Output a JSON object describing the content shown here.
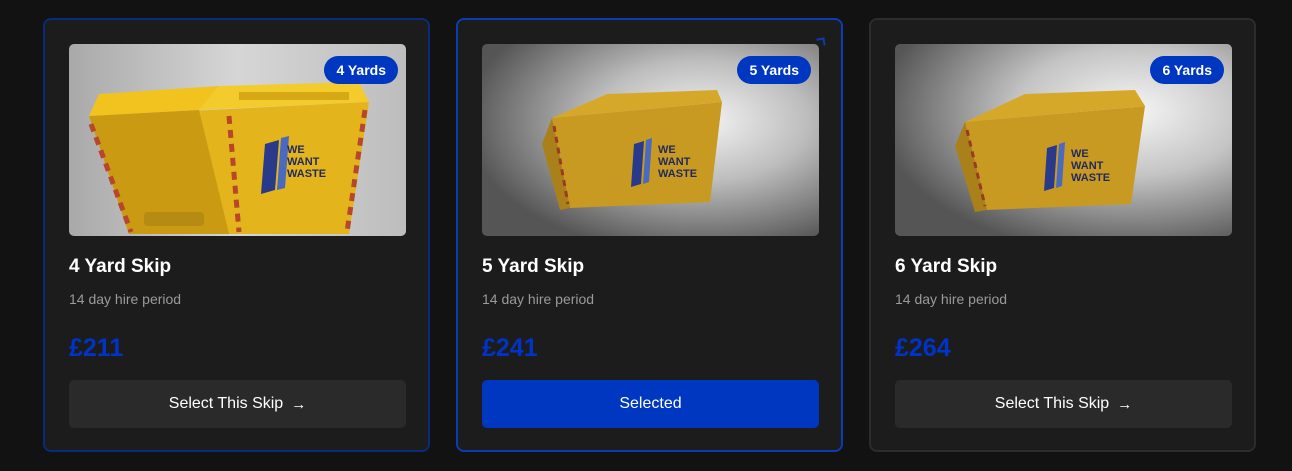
{
  "cards": [
    {
      "badge": "4 Yards",
      "title": "4 Yard Skip",
      "subtitle": "14 day hire period",
      "price": "£211",
      "button": "Select This Skip",
      "selected": false,
      "logo_lines": [
        "WE",
        "WANT",
        "WASTE"
      ]
    },
    {
      "badge": "5 Yards",
      "title": "5 Yard Skip",
      "subtitle": "14 day hire period",
      "price": "£241",
      "button": "Selected",
      "selected": true,
      "logo_lines": [
        "WE",
        "WANT",
        "WASTE"
      ]
    },
    {
      "badge": "6 Yards",
      "title": "6 Yard Skip",
      "subtitle": "14 day hire period",
      "price": "£264",
      "button": "Select This Skip",
      "selected": false,
      "logo_lines": [
        "WE",
        "WANT",
        "WASTE"
      ]
    }
  ],
  "icons": {
    "button_arrow": "arrow-right-icon"
  },
  "colors": {
    "accent": "#0037c1",
    "price": "#0033c7",
    "skip_yellow": "#e8b81a"
  }
}
